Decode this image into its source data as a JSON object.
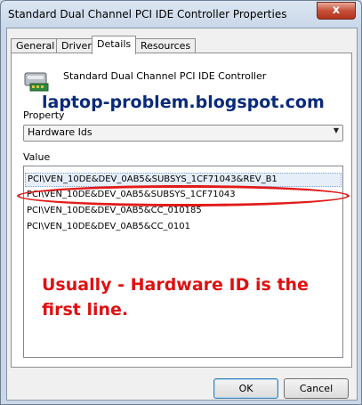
{
  "window": {
    "title": "Standard Dual Channel PCI IDE Controller Properties",
    "close_label": "x"
  },
  "tabs": [
    {
      "label": "General"
    },
    {
      "label": "Driver"
    },
    {
      "label": "Details",
      "active": true
    },
    {
      "label": "Resources"
    }
  ],
  "device": {
    "icon": "ide-controller-icon",
    "name": "Standard Dual Channel PCI IDE Controller"
  },
  "watermark": "laptop-problem.blogspot.com",
  "property": {
    "label": "Property",
    "selected": "Hardware Ids"
  },
  "value": {
    "label": "Value",
    "items": [
      "PCI\\VEN_10DE&DEV_0AB5&SUBSYS_1CF71043&REV_B1",
      "PCI\\VEN_10DE&DEV_0AB5&SUBSYS_1CF71043",
      "PCI\\VEN_10DE&DEV_0AB5&CC_010185",
      "PCI\\VEN_10DE&DEV_0AB5&CC_0101"
    ]
  },
  "annotation": {
    "text": "Usually - Hardware ID is the first line.",
    "color": "#e01010"
  },
  "buttons": {
    "ok": "OK",
    "cancel": "Cancel"
  }
}
